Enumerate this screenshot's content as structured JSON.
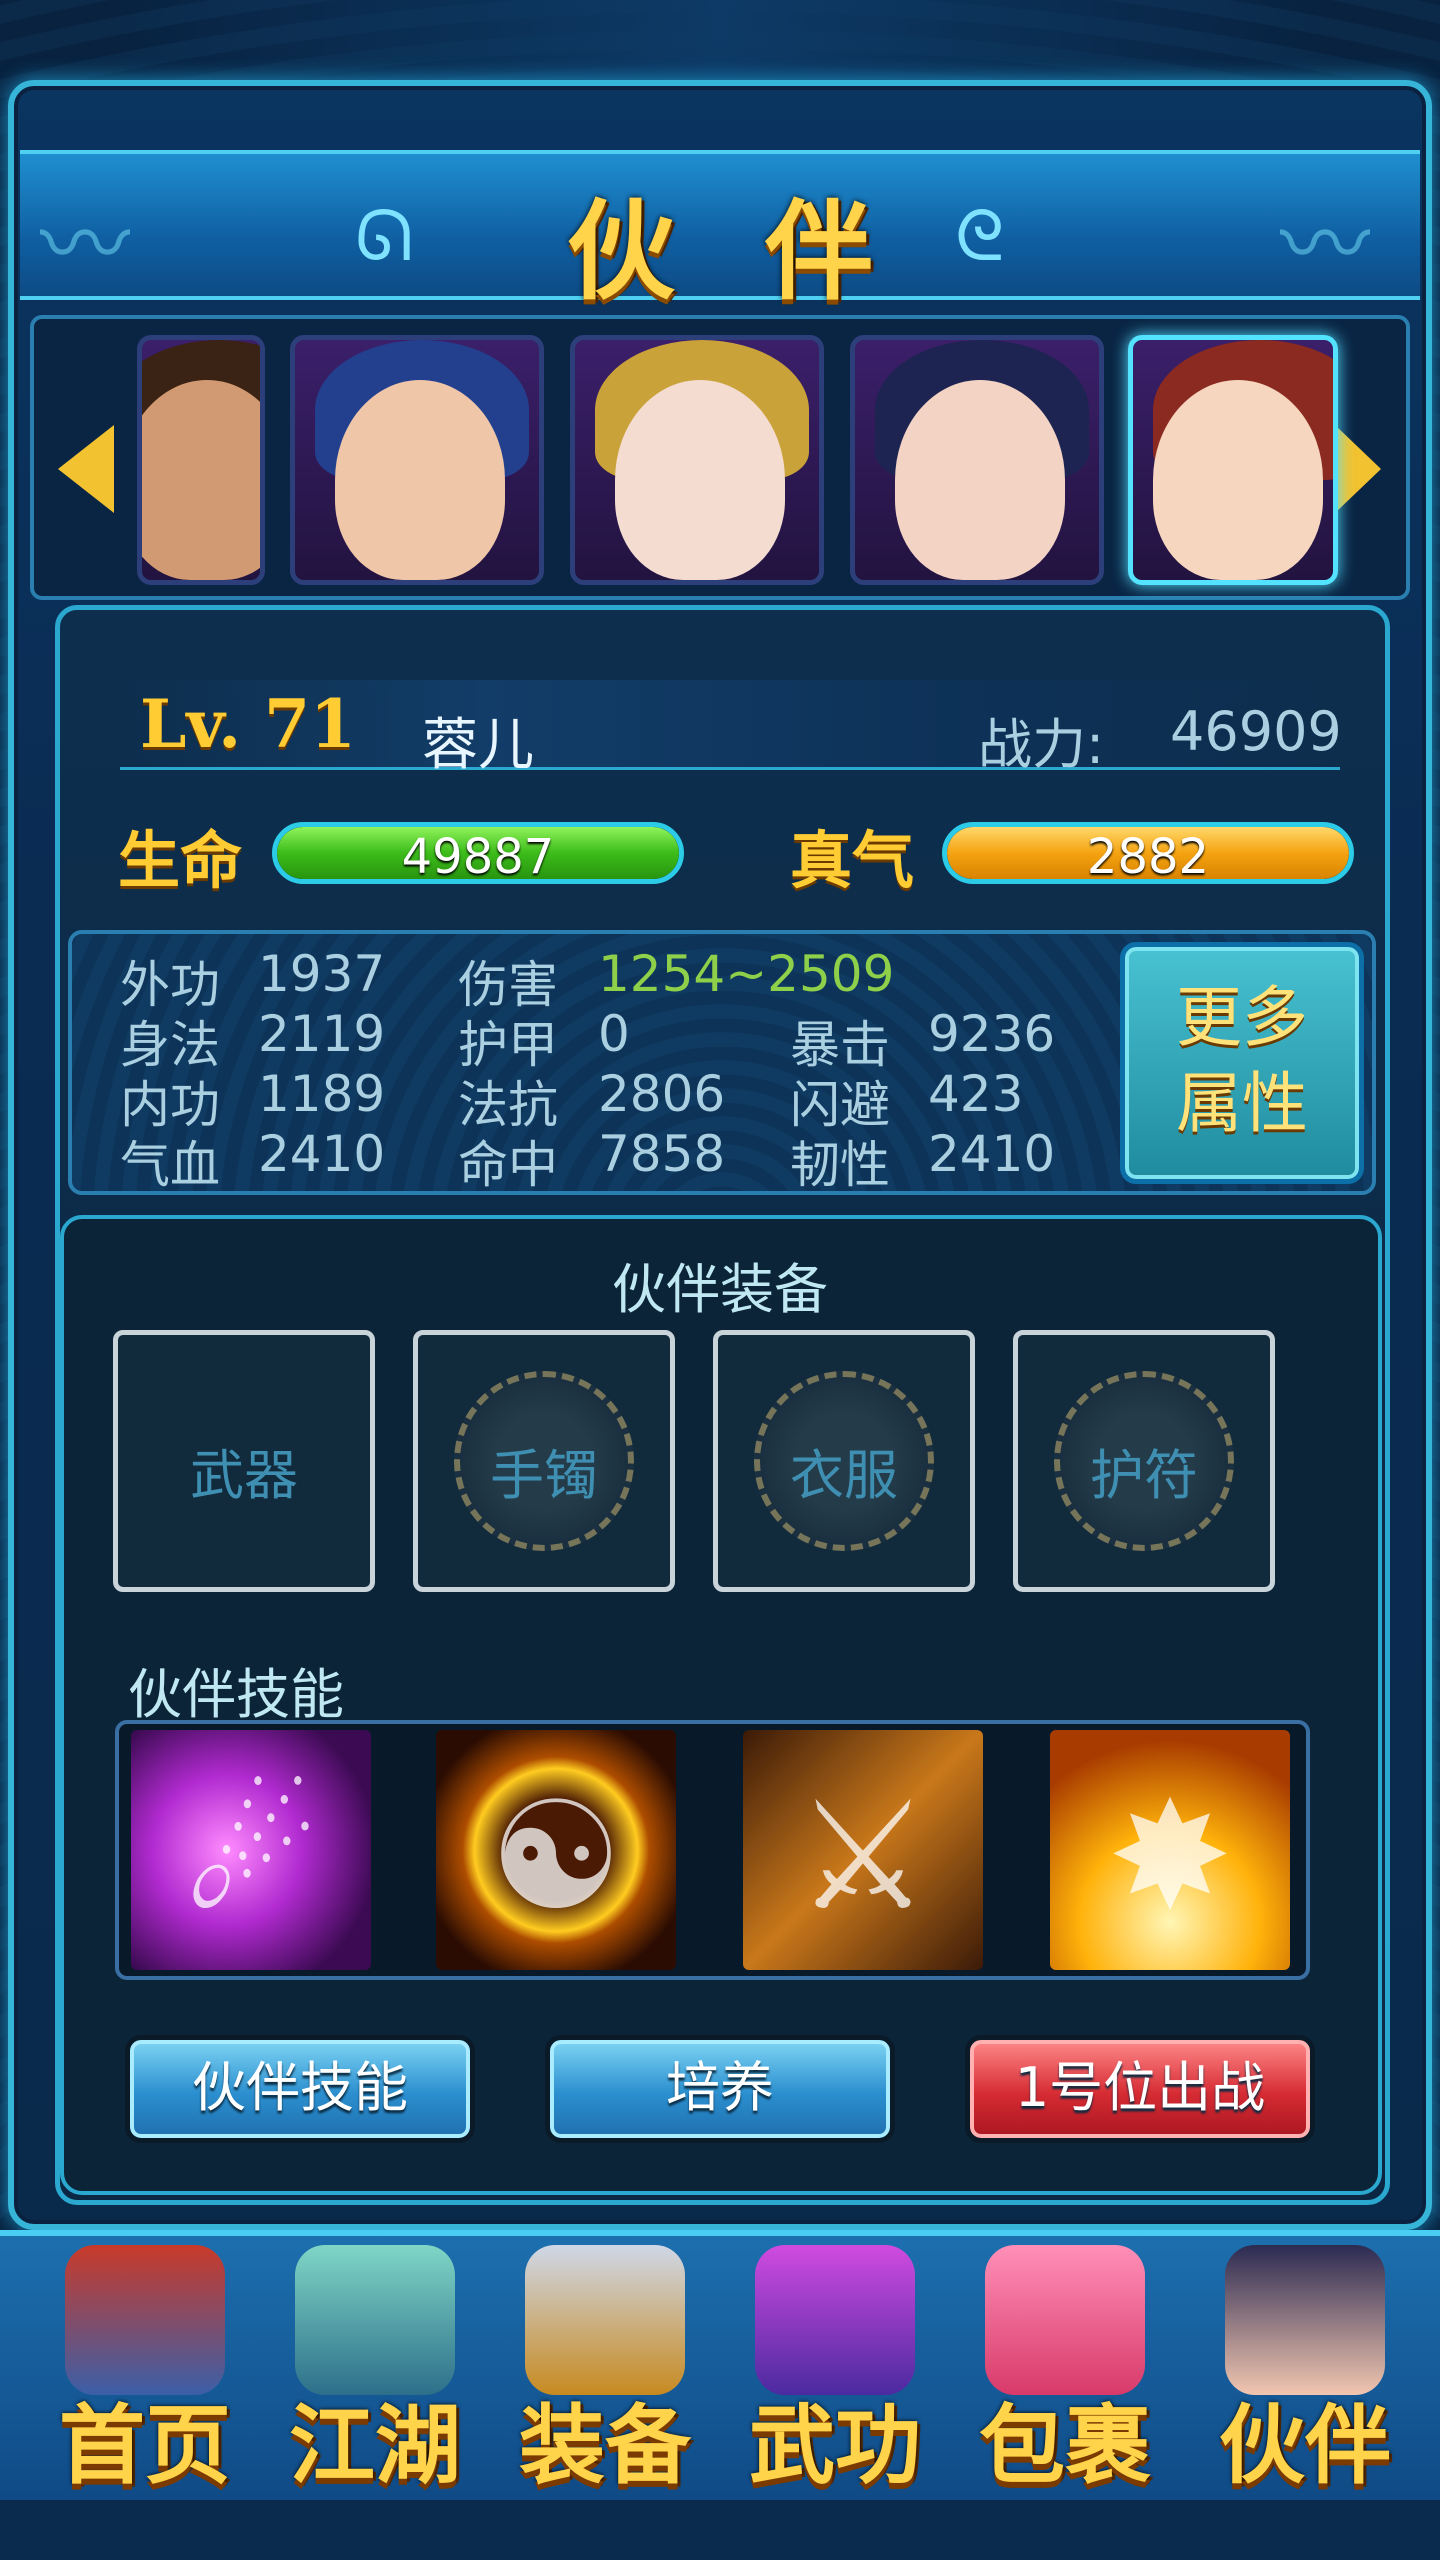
{
  "header": {
    "title": "伙伴"
  },
  "partner": {
    "level": "Lv. 71",
    "name": "蓉儿",
    "power_label": "战力:",
    "power_value": "46909",
    "hp_label": "生命",
    "hp_value": "49887",
    "mp_label": "真气",
    "mp_value": "2882"
  },
  "stats": [
    {
      "label": "外功",
      "value": "1937"
    },
    {
      "label": "伤害",
      "value": "1254~2509"
    },
    {
      "label": "身法",
      "value": "2119"
    },
    {
      "label": "护甲",
      "value": "0"
    },
    {
      "label": "暴击",
      "value": "9236"
    },
    {
      "label": "内功",
      "value": "1189"
    },
    {
      "label": "法抗",
      "value": "2806"
    },
    {
      "label": "闪避",
      "value": "423"
    },
    {
      "label": "气血",
      "value": "2410"
    },
    {
      "label": "命中",
      "value": "7858"
    },
    {
      "label": "韧性",
      "value": "2410"
    }
  ],
  "more_button": {
    "line1": "更多",
    "line2": "属性"
  },
  "equipment": {
    "title": "伙伴装备",
    "slots": [
      "武器",
      "手镯",
      "衣服",
      "护符"
    ]
  },
  "skills": {
    "title": "伙伴技能"
  },
  "buttons": {
    "skills": "伙伴技能",
    "train": "培养",
    "deploy": "1号位出战"
  },
  "nav": [
    "首页",
    "江湖",
    "装备",
    "武功",
    "包裹",
    "伙伴"
  ]
}
